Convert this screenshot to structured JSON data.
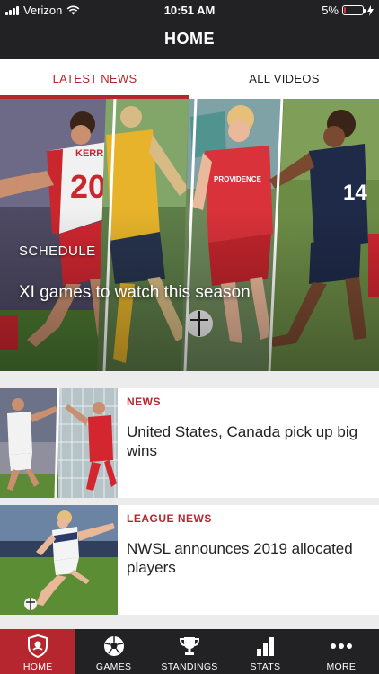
{
  "status_bar": {
    "carrier": "Verizon",
    "time": "10:51 AM",
    "battery_text": "5%",
    "battery_level": 0.05,
    "battery_color": "#e0323b"
  },
  "header": {
    "title": "HOME"
  },
  "tabs": [
    {
      "label": "LATEST NEWS",
      "active": true
    },
    {
      "label": "ALL VIDEOS",
      "active": false
    }
  ],
  "hero": {
    "category": "SCHEDULE",
    "title": "XI games to watch this season",
    "image": "soccer-players-collage",
    "jersey_numbers": [
      "20",
      "14"
    ],
    "jersey_names": [
      "KERR"
    ],
    "sponsor_text": "PROVIDENCE"
  },
  "news": [
    {
      "category": "NEWS",
      "title": "United States, Canada pick up big wins",
      "image": "soccer-players-collage"
    },
    {
      "category": "LEAGUE NEWS",
      "title": "NWSL announces 2019 allocated players",
      "image": "soccer-player-kicking"
    }
  ],
  "bottom_nav": [
    {
      "label": "HOME",
      "icon": "nwsl-shield-icon",
      "active": true
    },
    {
      "label": "GAMES",
      "icon": "soccer-ball-icon",
      "active": false
    },
    {
      "label": "STANDINGS",
      "icon": "trophy-icon",
      "active": false
    },
    {
      "label": "STATS",
      "icon": "bar-chart-icon",
      "active": false
    },
    {
      "label": "MORE",
      "icon": "more-dots-icon",
      "active": false
    }
  ],
  "colors": {
    "accent": "#b5262e",
    "dark_bar": "#222225",
    "background": "#ececec"
  }
}
